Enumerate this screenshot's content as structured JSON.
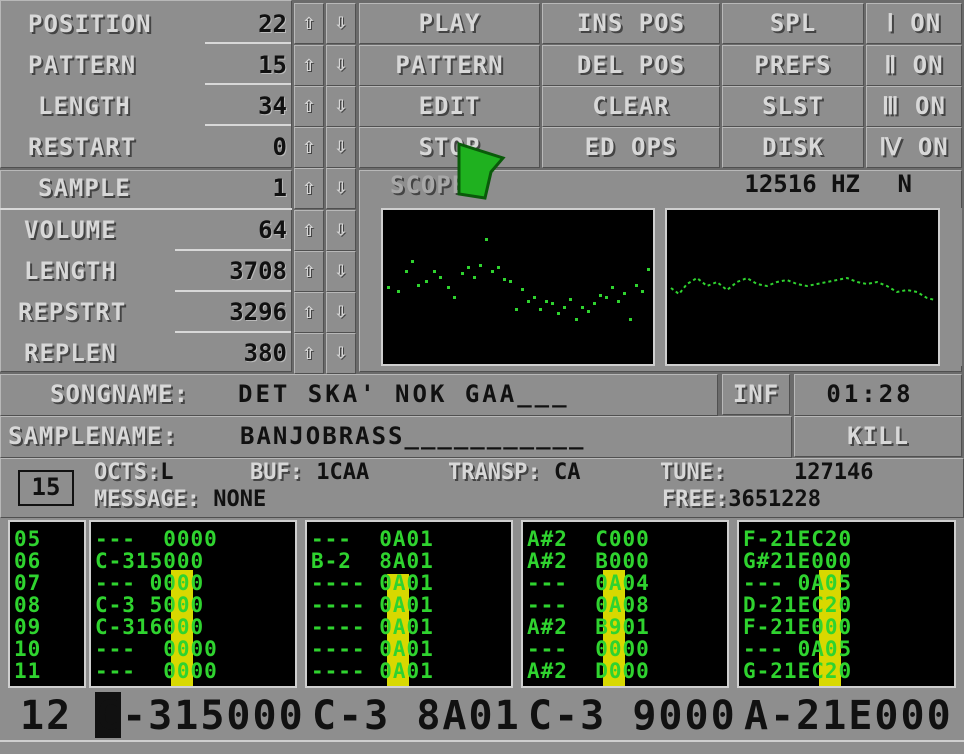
{
  "song": {
    "position": {
      "label": "POSITION",
      "value": "22"
    },
    "pattern": {
      "label": "PATTERN",
      "value": "15"
    },
    "length": {
      "label": "LENGTH",
      "value": "34"
    },
    "restart": {
      "label": "RESTART",
      "value": "0"
    }
  },
  "sample": {
    "sample": {
      "label": "SAMPLE",
      "value": "1"
    },
    "volume": {
      "label": "VOLUME",
      "value": "64"
    },
    "length": {
      "label": "LENGTH",
      "value": "3708"
    },
    "repstrt": {
      "label": "REPSTRT",
      "value": "3296"
    },
    "replen": {
      "label": "REPLEN",
      "value": "380"
    }
  },
  "arrows": {
    "up": "⇧",
    "down": "⇩"
  },
  "buttons": {
    "play": "PLAY",
    "pattern": "PATTERN",
    "edit": "EDIT",
    "stop": "STOP",
    "ins_pos": "INS POS",
    "del_pos": "DEL POS",
    "clear": "CLEAR",
    "ed_ops": "ED OPS",
    "spl": "SPL",
    "prefs": "PREFS",
    "slst": "SLST",
    "disk": "DISK",
    "ch1": "Ⅰ ON",
    "ch2": "Ⅱ ON",
    "ch3": "Ⅲ ON",
    "ch4": "Ⅳ ON"
  },
  "scope": {
    "label": "SCOPE",
    "freq": "12516 HZ",
    "mode": "N"
  },
  "songname": {
    "label": "SONGNAME:",
    "value": "DET SKA' NOK GAA___",
    "inf": "INF",
    "time": "01:28"
  },
  "samplename": {
    "label": "SAMPLENAME:",
    "value": "BANJOBRASS___________",
    "kill": "KILL"
  },
  "status": {
    "pattern_num": "15",
    "octs_label": "OCTS:",
    "octs_value": "L",
    "buf_label": "BUF:",
    "buf_value": "1CAA",
    "transp_label": "TRANSP:",
    "transp_value": "CA",
    "tune_label": "TUNE:",
    "tune_value": "127146",
    "message_label": "MESSAGE:",
    "message_value": "NONE",
    "free_label": "FREE:",
    "free_value": "3651228"
  },
  "tracks": {
    "rows": [
      "05",
      "06",
      "07",
      "08",
      "09",
      "10",
      "11"
    ],
    "ch1": [
      "---  0000",
      "C-315000",
      "--- 0000",
      "C-3 5000",
      "C-316000",
      "---  0000",
      "---  0000"
    ],
    "ch2": [
      "---  0A01",
      "B-2  8A01",
      "---- 0A01",
      "---- 0A01",
      "---- 0A01",
      "---- 0A01",
      "---- 0A01"
    ],
    "ch3": [
      "A#2  C000",
      "A#2  B000",
      "---  0A04",
      "---  0A08",
      "A#2  B901",
      "---  0000",
      "A#2  D000"
    ],
    "ch4": [
      "F-21EC20",
      "G#21E000",
      "--- 0A05",
      "D-21EC20",
      "F-21E000",
      "--- 0A05",
      "G-21EC20"
    ]
  },
  "current_row": {
    "num": "12",
    "ch1": "C-315000",
    "ch2": "C-3 8A01",
    "ch3": "C-3 9000",
    "ch4": "A-21E000"
  },
  "colors": {
    "panel": "#8e8e8e",
    "text_light": "#d8d8d8",
    "green": "#2fd32f",
    "cursor": "#d8d800"
  }
}
